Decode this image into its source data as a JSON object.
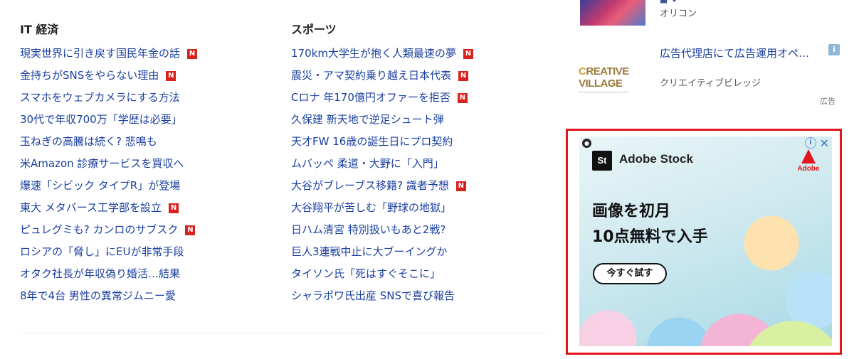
{
  "it_section": {
    "title": "IT 経済",
    "items": [
      {
        "text": "現実世界に引き戻す国民年金の話",
        "badge": "N"
      },
      {
        "text": "金持ちがSNSをやらない理由",
        "badge": "N"
      },
      {
        "text": "スマホをウェブカメラにする方法",
        "badge": ""
      },
      {
        "text": "30代で年収700万「学歴は必要」",
        "badge": ""
      },
      {
        "text": "玉ねぎの高騰は続く? 悲鳴も",
        "badge": ""
      },
      {
        "text": "米Amazon 診療サービスを買収へ",
        "badge": ""
      },
      {
        "text": "爆速「シビック タイプR」が登場",
        "badge": ""
      },
      {
        "text": "東大 メタバース工学部を設立",
        "badge": "N"
      },
      {
        "text": "ピュレグミも? カンロのサブスク",
        "badge": "N"
      },
      {
        "text": "ロシアの「脅し」にEUが非常手段",
        "badge": ""
      },
      {
        "text": "オタク社長が年収偽り婚活…結果",
        "badge": ""
      },
      {
        "text": "8年で4台 男性の異常ジムニー愛",
        "badge": ""
      }
    ]
  },
  "sports_section": {
    "title": "スポーツ",
    "items": [
      {
        "text": "170km大学生が抱く人類最速の夢",
        "badge": "N"
      },
      {
        "text": "震災・アマ契約乗り越え日本代表",
        "badge": "N"
      },
      {
        "text": "Cロナ 年170億円オファーを拒否",
        "badge": "N"
      },
      {
        "text": "久保建 新天地で逆足シュート弾",
        "badge": ""
      },
      {
        "text": "天才FW 16歳の誕生日にプロ契約",
        "badge": ""
      },
      {
        "text": "ムバッペ 柔道・大野に「入門」",
        "badge": ""
      },
      {
        "text": "大谷がブレーブス移籍? 識者予想",
        "badge": "N"
      },
      {
        "text": "大谷翔平が苦しむ「野球の地獄」",
        "badge": ""
      },
      {
        "text": "日ハム清宮 特別扱いもあと2戦?",
        "badge": ""
      },
      {
        "text": "巨人3連戦中止に大ブーイングか",
        "badge": ""
      },
      {
        "text": "タイソン氏「死はすぐそこに」",
        "badge": ""
      },
      {
        "text": "シャラポワ氏出産 SNSで喜び報告",
        "badge": ""
      }
    ]
  },
  "right_column": {
    "oricon_source": "オリコン",
    "promo": {
      "logo_text_accent": "C",
      "logo_text_rest": "REATIVE VILLAGE",
      "title": "広告代理店にて広告運用オペ…",
      "source": "クリエイティブビレッジ",
      "ad_label": "広告"
    }
  },
  "adobe_ad": {
    "brand_mark": "St",
    "brand_name": "Adobe Stock",
    "adobe_label": "Adobe",
    "headline_line1": "画像を初月",
    "headline_line2": "10点無料で入手",
    "cta": "今すぐ試す",
    "info_symbol": "i",
    "close_symbol": "✕"
  },
  "colors": {
    "link": "#1a3fa0",
    "badge": "#d9221d",
    "highlight_border": "#e0151d",
    "adobe_red": "#e3151d"
  }
}
